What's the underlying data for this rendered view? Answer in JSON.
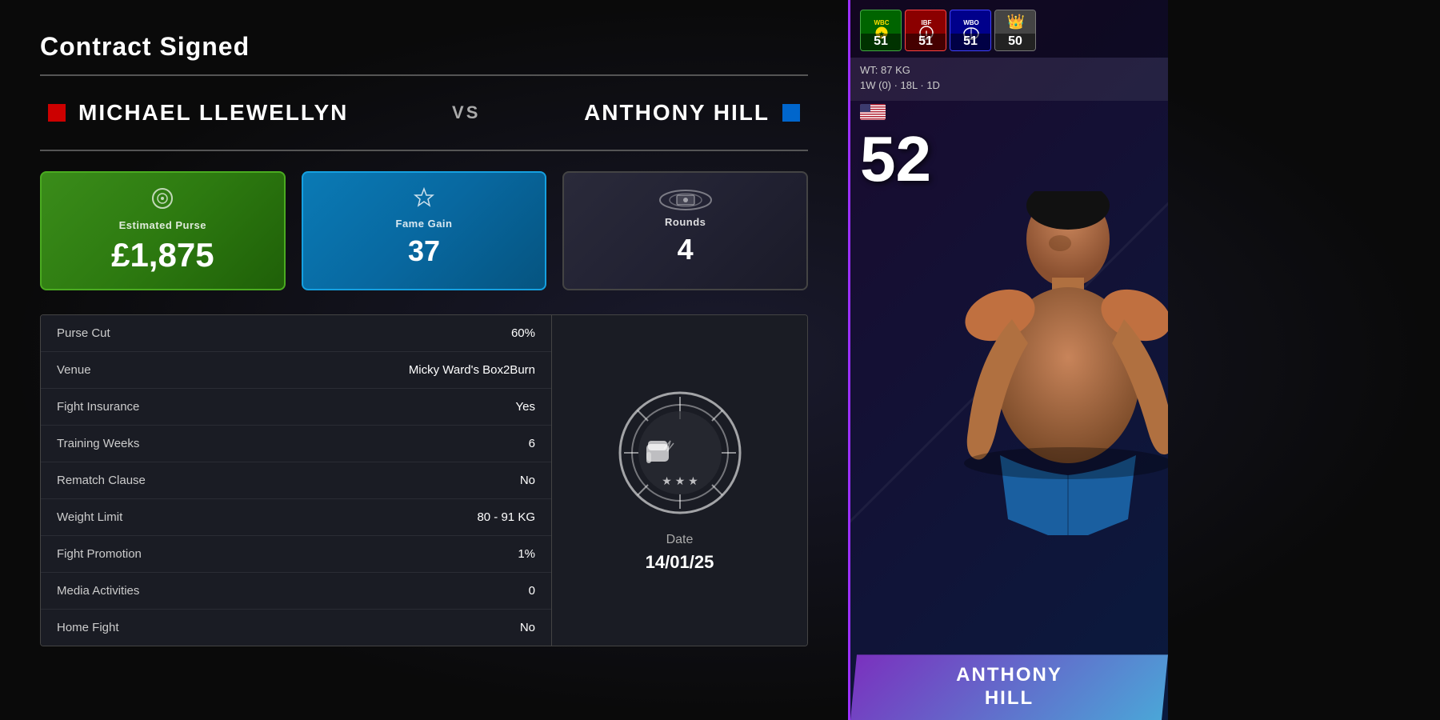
{
  "page": {
    "title": "Contract Signed"
  },
  "matchup": {
    "fighter1": {
      "name": "MICHAEL LLEWELLYN",
      "color": "red"
    },
    "vs": "VS",
    "fighter2": {
      "name": "ANTHONY HILL",
      "color": "blue"
    }
  },
  "stats_cards": {
    "purse": {
      "label": "Estimated Purse",
      "value": "£1,875",
      "icon": "💰"
    },
    "fame": {
      "label": "Fame Gain",
      "value": "37",
      "icon": "⭐"
    },
    "rounds": {
      "label": "Rounds",
      "value": "4",
      "icon": "🥊"
    }
  },
  "details": [
    {
      "label": "Purse Cut",
      "value": "60%"
    },
    {
      "label": "Venue",
      "value": "Micky Ward's Box2Burn"
    },
    {
      "label": "Fight Insurance",
      "value": "Yes"
    },
    {
      "label": "Training Weeks",
      "value": "6"
    },
    {
      "label": "Rematch Clause",
      "value": "No"
    },
    {
      "label": "Weight Limit",
      "value": "80 - 91 KG"
    },
    {
      "label": "Fight Promotion",
      "value": "1%"
    },
    {
      "label": "Media Activities",
      "value": "0"
    },
    {
      "label": "Home Fight",
      "value": "No"
    }
  ],
  "fight_info": {
    "date_label": "Date",
    "date_value": "14/01/25"
  },
  "fighter_card": {
    "name_line1": "ANTHONY",
    "name_line2": "HILL",
    "rating": "52",
    "weight": "WT: 87 KG",
    "record": "1W (0) · 18L · 1D",
    "badges": [
      {
        "org": "WBC",
        "score": "51",
        "color": "green"
      },
      {
        "org": "IBF",
        "score": "51",
        "color": "red"
      },
      {
        "org": "WBO",
        "score": "51",
        "color": "blue"
      },
      {
        "org": "★",
        "score": "50",
        "color": "gray"
      }
    ]
  }
}
